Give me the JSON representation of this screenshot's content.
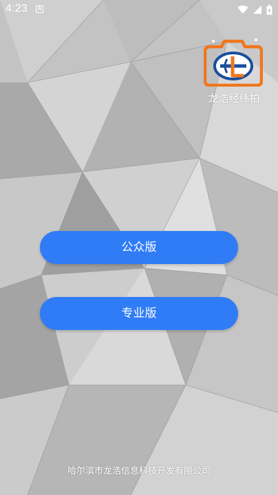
{
  "status_bar": {
    "time": "4:23",
    "notification_badge": "A",
    "icons": [
      "wifi-icon",
      "signal-icon",
      "battery-icon"
    ]
  },
  "header": {
    "app_name": "龙浩经纬拍",
    "logo_icon": "camera-logo-icon"
  },
  "actions": {
    "public_label": "公众版",
    "pro_label": "专业版"
  },
  "footer": {
    "company": "哈尔滨市龙浩信息科技开发有限公司"
  },
  "colors": {
    "button": "#2f7cf6",
    "logo_orange": "#f0761e",
    "logo_blue": "#1a4d9c"
  }
}
